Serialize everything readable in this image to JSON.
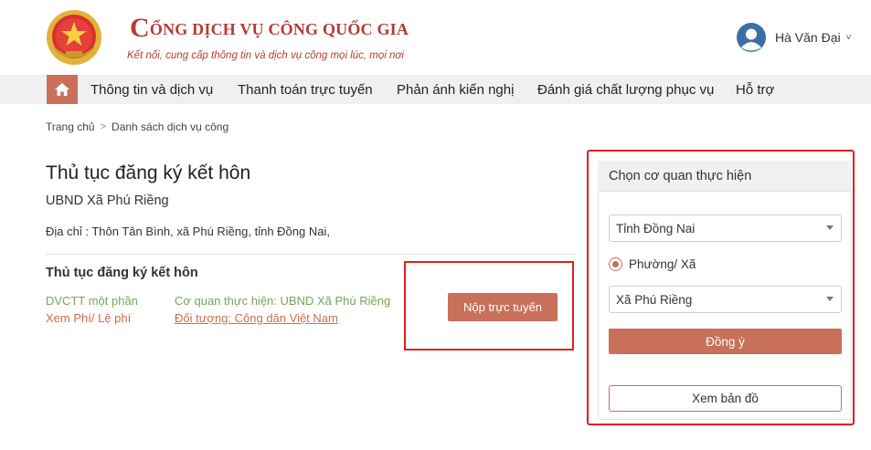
{
  "header": {
    "brand_initial": "C",
    "brand_rest": "ỔNG DỊCH VỤ CÔNG QUỐC GIA",
    "slogan": "Kết nối, cung cấp thông tin và dịch vụ công mọi lúc, mọi nơi",
    "user_name": "Hà Văn Đại",
    "user_chevron": "˅"
  },
  "nav": {
    "items": [
      {
        "label": "Thông tin và dịch vụ"
      },
      {
        "label": "Thanh toán trực tuyến"
      },
      {
        "label": "Phản ánh kiến nghị"
      },
      {
        "label": "Đánh giá chất lượng phục vụ"
      },
      {
        "label": "Hỗ trợ"
      }
    ]
  },
  "breadcrumb": {
    "home": "Trang chủ",
    "separator": ">",
    "current": "Danh sách dịch vụ công"
  },
  "procedure": {
    "title": "Thủ tục đăng ký kết hôn",
    "agency": "UBND Xã Phú Riềng",
    "address": "Địa chỉ : Thôn Tân Bình, xã Phú Riềng, tỉnh Đồng Nai,",
    "item_title": "Thủ tục đăng ký kết hôn",
    "level": "DVCTT một phần",
    "fee_link": "Xem Phí/ Lệ phí",
    "exec_agency": "Cơ quan thực hiện: UBND Xã Phú Riềng",
    "subject_link": "Đối tượng: Công dân Việt Nam",
    "submit_label": "Nộp trực tuyến"
  },
  "panel": {
    "title": "Chọn cơ quan thực hiện",
    "province": "Tỉnh Đồng Nai",
    "radio_label": "Phường/ Xã",
    "ward": "Xã Phú Riềng",
    "agree_label": "Đồng ý",
    "map_label": "Xem bản đồ"
  },
  "colors": {
    "brand_red": "#b43c35",
    "accent": "#c8705a",
    "green": "#7aa35a",
    "highlight": "#e0201b"
  }
}
